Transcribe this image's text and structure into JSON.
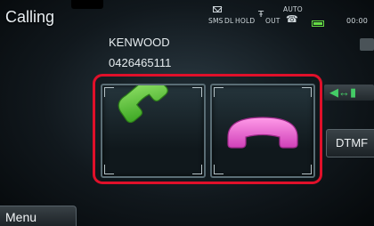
{
  "header": {
    "title": "Calling",
    "status": {
      "sms_label": "SMS",
      "dl_label": "DL",
      "hold_label": "HOLD",
      "signal_label": "Ȳout",
      "auto_label": "AUTO",
      "clock": "00:00",
      "battery_color": "#66dd44"
    }
  },
  "call": {
    "name": "KENWOOD",
    "number": "0426465111",
    "answer_icon": "phone-answer-icon",
    "hangup_icon": "phone-hangup-icon",
    "answer_color": "#5ec83a",
    "hangup_color": "#e866d0",
    "highlight_color": "#e0102a"
  },
  "side": {
    "audio_icon": "handsfree-audio-icon",
    "dtmf_label": "DTMF"
  },
  "footer": {
    "menu_label": "Menu"
  }
}
